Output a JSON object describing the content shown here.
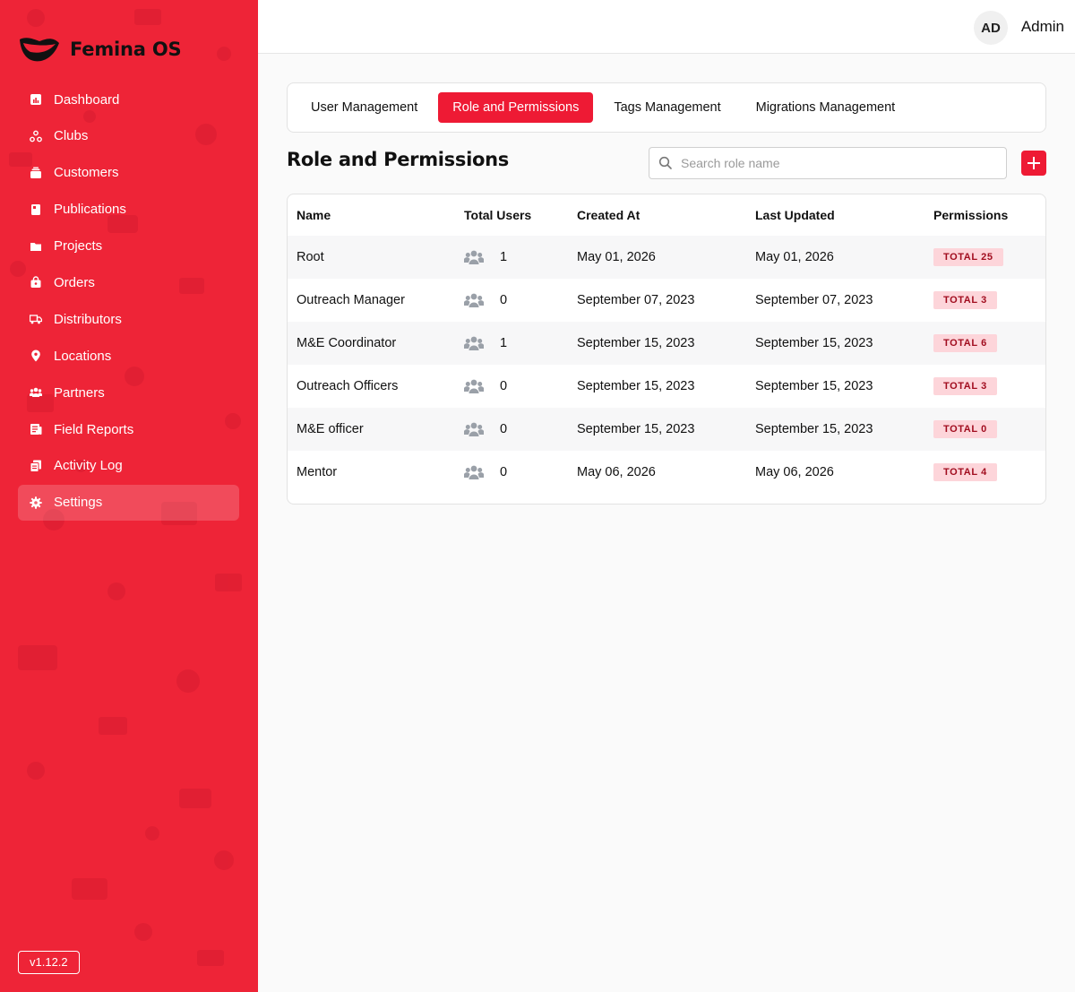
{
  "brand": {
    "name": "Femina OS"
  },
  "sidebar": {
    "items": [
      {
        "label": "Dashboard",
        "icon": "chart-icon"
      },
      {
        "label": "Clubs",
        "icon": "clubs-icon"
      },
      {
        "label": "Customers",
        "icon": "customers-icon"
      },
      {
        "label": "Publications",
        "icon": "book-icon"
      },
      {
        "label": "Projects",
        "icon": "folder-icon"
      },
      {
        "label": "Orders",
        "icon": "bag-icon"
      },
      {
        "label": "Distributors",
        "icon": "truck-icon"
      },
      {
        "label": "Locations",
        "icon": "pin-icon"
      },
      {
        "label": "Partners",
        "icon": "partners-icon"
      },
      {
        "label": "Field Reports",
        "icon": "report-icon"
      },
      {
        "label": "Activity Log",
        "icon": "log-icon"
      },
      {
        "label": "Settings",
        "icon": "gear-icon",
        "active": true
      }
    ],
    "version": "v1.12.2"
  },
  "header": {
    "avatar_initials": "AD",
    "user_name": "Admin"
  },
  "tabs": [
    {
      "label": "User Management"
    },
    {
      "label": "Role and Permissions",
      "active": true
    },
    {
      "label": "Tags Management"
    },
    {
      "label": "Migrations Management"
    }
  ],
  "page": {
    "title": "Role and Permissions"
  },
  "search": {
    "placeholder": "Search role name",
    "value": ""
  },
  "table": {
    "columns": [
      "Name",
      "Total Users",
      "Created At",
      "Last Updated",
      "Permissions"
    ],
    "rows": [
      {
        "name": "Root",
        "total_users": "1",
        "created_at": "May 01, 2026",
        "last_updated": "May 01, 2026",
        "permissions": "TOTAL 25"
      },
      {
        "name": "Outreach Manager",
        "total_users": "0",
        "created_at": "September 07, 2023",
        "last_updated": "September 07, 2023",
        "permissions": "TOTAL 3"
      },
      {
        "name": "M&E Coordinator",
        "total_users": "1",
        "created_at": "September 15, 2023",
        "last_updated": "September 15, 2023",
        "permissions": "TOTAL 6"
      },
      {
        "name": "Outreach Officers",
        "total_users": "0",
        "created_at": "September 15, 2023",
        "last_updated": "September 15, 2023",
        "permissions": "TOTAL 3"
      },
      {
        "name": "M&E officer",
        "total_users": "0",
        "created_at": "September 15, 2023",
        "last_updated": "September 15, 2023",
        "permissions": "TOTAL 0"
      },
      {
        "name": "Mentor",
        "total_users": "0",
        "created_at": "May 06, 2026",
        "last_updated": "May 06, 2026",
        "permissions": "TOTAL 4"
      }
    ]
  },
  "colors": {
    "brand_red": "#ee2437",
    "accent_red": "#ee1a34",
    "badge_bg": "#fdd5da",
    "badge_text": "#a10d1f"
  }
}
